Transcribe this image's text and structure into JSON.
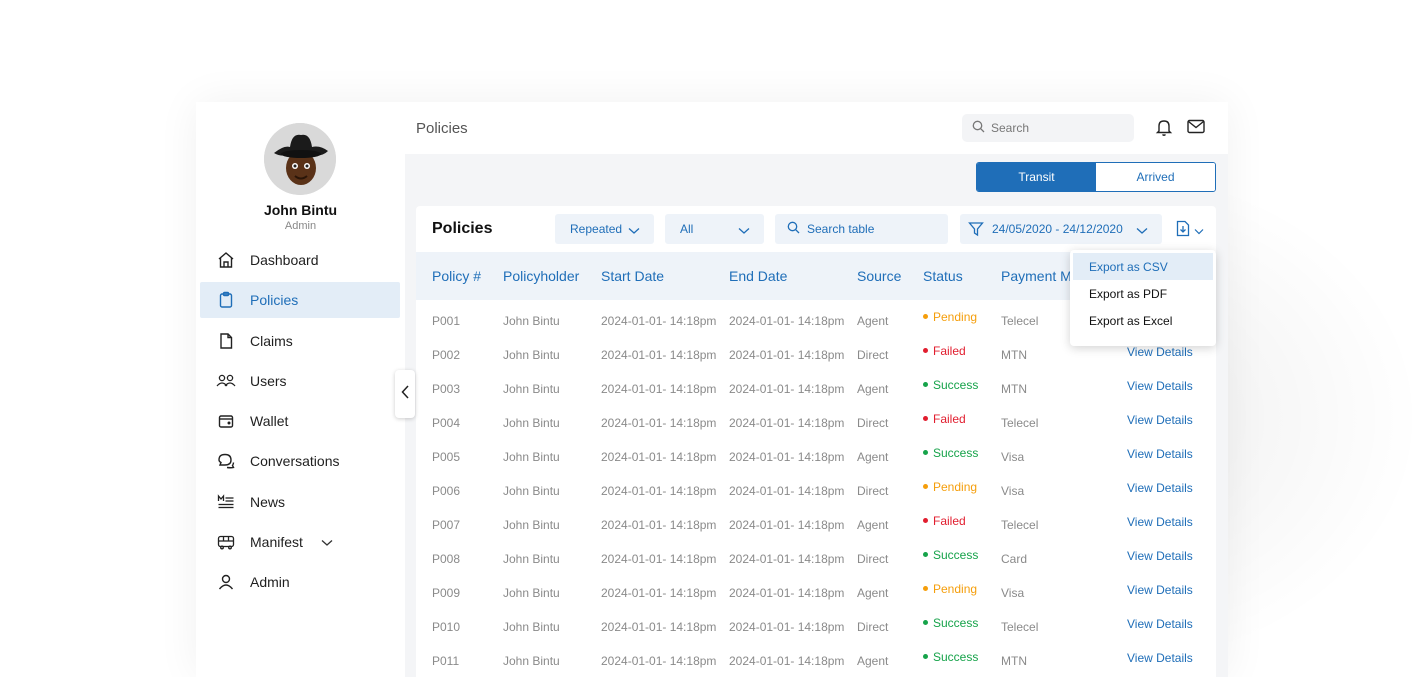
{
  "user": {
    "name": "John Bintu",
    "role": "Admin"
  },
  "sidebar": {
    "items": [
      {
        "label": "Dashboard",
        "icon": "home-icon",
        "active": false
      },
      {
        "label": "Policies",
        "icon": "clipboard-icon",
        "active": true
      },
      {
        "label": "Claims",
        "icon": "file-icon",
        "active": false
      },
      {
        "label": "Users",
        "icon": "users-icon",
        "active": false
      },
      {
        "label": "Wallet",
        "icon": "wallet-icon",
        "active": false
      },
      {
        "label": "Conversations",
        "icon": "chat-icon",
        "active": false
      },
      {
        "label": "News",
        "icon": "news-icon",
        "active": false
      },
      {
        "label": "Manifest",
        "icon": "bus-icon",
        "active": false
      },
      {
        "label": "Admin",
        "icon": "user-icon",
        "active": false
      }
    ]
  },
  "header": {
    "title": "Policies",
    "search_placeholder": "Search"
  },
  "toggle": {
    "transit": "Transit",
    "arrived": "Arrived",
    "selected": "Transit"
  },
  "card": {
    "title": "Policies",
    "filter_repeated": "Repeated",
    "filter_all": "All",
    "search_placeholder": "Search table",
    "date_range": "24/05/2020 - 24/12/2020"
  },
  "export_menu": [
    "Export as CSV",
    "Export as PDF",
    "Export as Excel"
  ],
  "table": {
    "headers": [
      "Policy #",
      "Policyholder",
      "Start Date",
      "End Date",
      "Source",
      "Status",
      "Payment M"
    ],
    "rows": [
      [
        "P001",
        "John Bintu",
        "2024-01-01- 14:18pm",
        "2024-01-01- 14:18pm",
        "Agent",
        "Pending",
        "Telecel",
        ""
      ],
      [
        "P002",
        "John Bintu",
        "2024-01-01- 14:18pm",
        "2024-01-01- 14:18pm",
        "Direct",
        "Failed",
        "MTN",
        "View Details"
      ],
      [
        "P003",
        "John Bintu",
        "2024-01-01- 14:18pm",
        "2024-01-01- 14:18pm",
        "Agent",
        "Success",
        "MTN",
        "View Details"
      ],
      [
        "P004",
        "John Bintu",
        "2024-01-01- 14:18pm",
        "2024-01-01- 14:18pm",
        "Direct",
        "Failed",
        "Telecel",
        "View Details"
      ],
      [
        "P005",
        "John Bintu",
        "2024-01-01- 14:18pm",
        "2024-01-01- 14:18pm",
        "Agent",
        "Success",
        "Visa",
        "View Details"
      ],
      [
        "P006",
        "John Bintu",
        "2024-01-01- 14:18pm",
        "2024-01-01- 14:18pm",
        "Direct",
        "Pending",
        "Visa",
        "View Details"
      ],
      [
        "P007",
        "John Bintu",
        "2024-01-01- 14:18pm",
        "2024-01-01- 14:18pm",
        "Agent",
        "Failed",
        "Telecel",
        "View Details"
      ],
      [
        "P008",
        "John Bintu",
        "2024-01-01- 14:18pm",
        "2024-01-01- 14:18pm",
        "Direct",
        "Success",
        "Card",
        "View Details"
      ],
      [
        "P009",
        "John Bintu",
        "2024-01-01- 14:18pm",
        "2024-01-01- 14:18pm",
        "Agent",
        "Pending",
        "Visa",
        "View Details"
      ],
      [
        "P010",
        "John Bintu",
        "2024-01-01- 14:18pm",
        "2024-01-01- 14:18pm",
        "Direct",
        "Success",
        "Telecel",
        "View Details"
      ],
      [
        "P011",
        "John Bintu",
        "2024-01-01- 14:18pm",
        "2024-01-01- 14:18pm",
        "Agent",
        "Success",
        "MTN",
        "View Details"
      ]
    ]
  },
  "colors": {
    "accent": "#1f6eb8",
    "pending": "#f59e0b",
    "failed": "#e11d2e",
    "success": "#16a34a"
  }
}
